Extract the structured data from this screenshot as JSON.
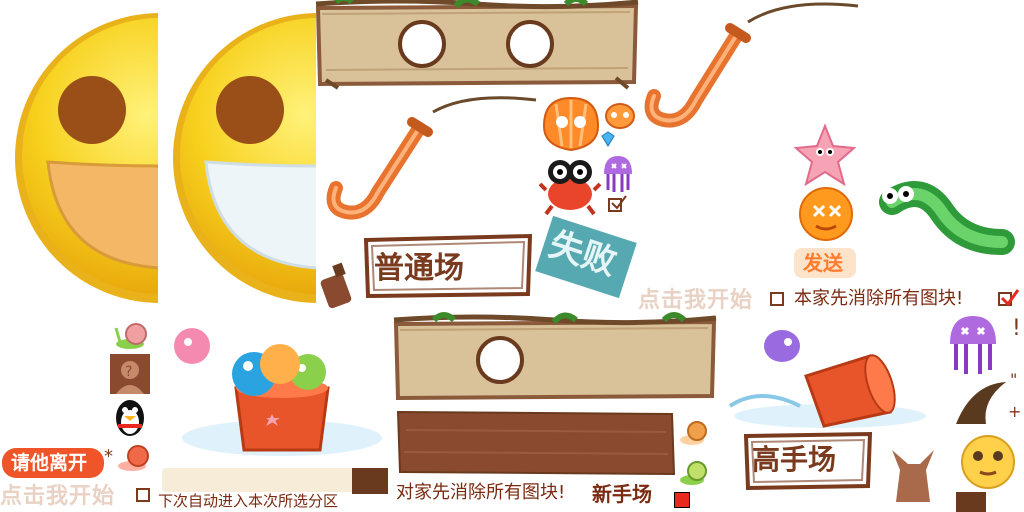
{
  "labels": {
    "normal_room": "普通场",
    "fail_stamp": "失败",
    "send": "发送",
    "click_start": "点击我开始",
    "self_clear_all": "本家先消除所有图块!",
    "ask_leave": "请他离开",
    "click_start_2": "点击我开始",
    "auto_enter": "下次自动进入本次所选分区",
    "opponent_clear_all": "对家先消除所有图块!",
    "newbie_room": "新手场",
    "expert_room": "高手场",
    "star_mark": "*",
    "exclaim_mark": "!",
    "quote_mark": "\"",
    "plus_mark": "+"
  },
  "colors": {
    "smiley_yellow": "#f7d11e",
    "smiley_mouth": "#f3b765",
    "board_wood": "#d9c19a",
    "board_dark": "#8a4a30",
    "fail_teal": "#3a9aa3",
    "send_orange": "#ff7b2e",
    "leave_orange": "#f0552a",
    "cane_orange": "#e8732e"
  },
  "icons": [
    "smiley-face-icon",
    "wooden-board-icon",
    "walking-cane-icon",
    "shell-icon",
    "crab-icon",
    "jellyfish-icon",
    "gem-icon",
    "checkbox-icon",
    "starfish-icon",
    "orange-fish-icon",
    "green-worm-icon",
    "snail-icon",
    "question-avatar-icon",
    "qq-penguin-icon",
    "bucket-scene-icon",
    "pink-fish-icon",
    "fox-icon",
    "pufferfish-icon",
    "moon-icon",
    "bottle-icon"
  ]
}
